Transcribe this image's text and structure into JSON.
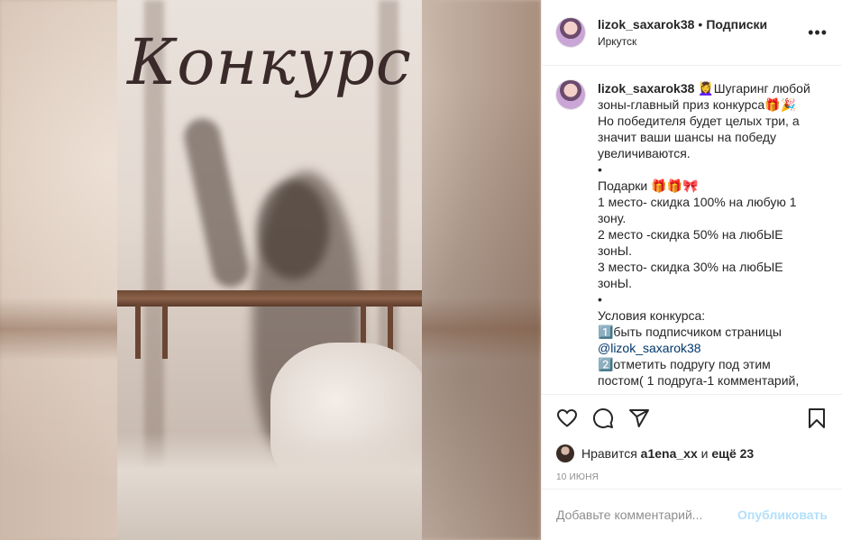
{
  "post": {
    "poster_text": "Конкурс"
  },
  "header": {
    "username": "lizok_saxarok38",
    "separator": "•",
    "follow_label": "Подписки",
    "location": "Иркутск",
    "more_icon": "ellipsis-icon"
  },
  "caption": {
    "username": "lizok_saxarok38",
    "lines": [
      " 💆‍♀️Шугаринг любой зоны-главный приз конкурса🎁🎉",
      "Но победителя будет целых три, а значит ваши шансы на победу увеличиваются.",
      "•",
      "Подарки 🎁🎁🎀",
      "1 место- скидка 100% на любую 1 зону.",
      "2 место -скидка 50% на любЫЕ зонЫ.",
      "3 место- скидка 30% на любЫЕ зонЫ.",
      "•",
      "Условия конкурса:",
      "1️⃣быть подписчиком страницы"
    ],
    "mention": "@lizok_saxarok38",
    "after_mention": "2️⃣отметить подругу под этим постом( 1 подруга-1 комментарий,"
  },
  "actions": {
    "like_icon": "heart-icon",
    "comment_icon": "comment-icon",
    "share_icon": "send-icon",
    "save_icon": "bookmark-icon"
  },
  "likes": {
    "prefix": "Нравится",
    "user": "a1ena_xx",
    "middle": "и",
    "rest": "ещё 23"
  },
  "date": "10 ИЮНЯ",
  "comment": {
    "placeholder": "Добавьте комментарий...",
    "publish_label": "Опубликовать"
  },
  "colors": {
    "link": "#00376b",
    "muted": "#8e8e8e",
    "publish_disabled": "#b2dffc"
  }
}
